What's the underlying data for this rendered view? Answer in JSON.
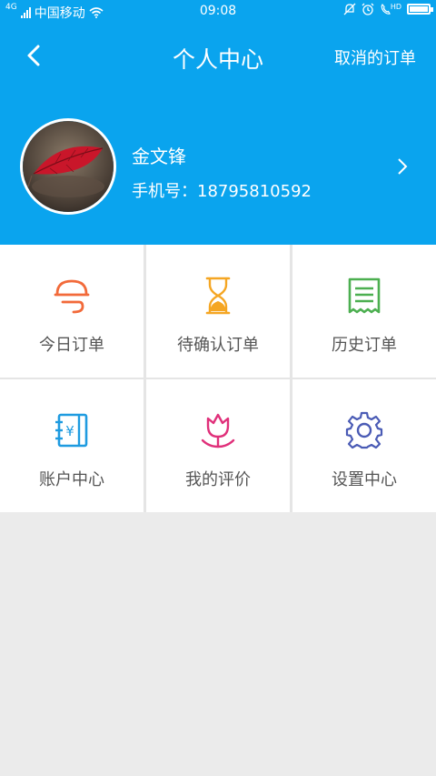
{
  "status_bar": {
    "network": "4G",
    "carrier": "中国移动",
    "time": "09:08",
    "hd": "HD",
    "battery_level": 0.9
  },
  "header": {
    "title": "个人中心",
    "action_label": "取消的订单"
  },
  "profile": {
    "name": "金文锋",
    "phone_label": "手机号：",
    "phone_number": "18795810592"
  },
  "menu": [
    {
      "label": "今日订单",
      "icon": "today-order-icon",
      "color": "#f26a3a"
    },
    {
      "label": "待确认订单",
      "icon": "hourglass-icon",
      "color": "#f5a623"
    },
    {
      "label": "历史订单",
      "icon": "receipt-icon",
      "color": "#4caf50"
    },
    {
      "label": "账户中心",
      "icon": "wallet-icon",
      "color": "#1e9be0"
    },
    {
      "label": "我的评价",
      "icon": "flower-icon",
      "color": "#e0307a"
    },
    {
      "label": "设置中心",
      "icon": "gear-icon",
      "color": "#4a5bb5"
    }
  ],
  "colors": {
    "brand": "#0aa4ee",
    "page_bg": "#ebebeb"
  }
}
